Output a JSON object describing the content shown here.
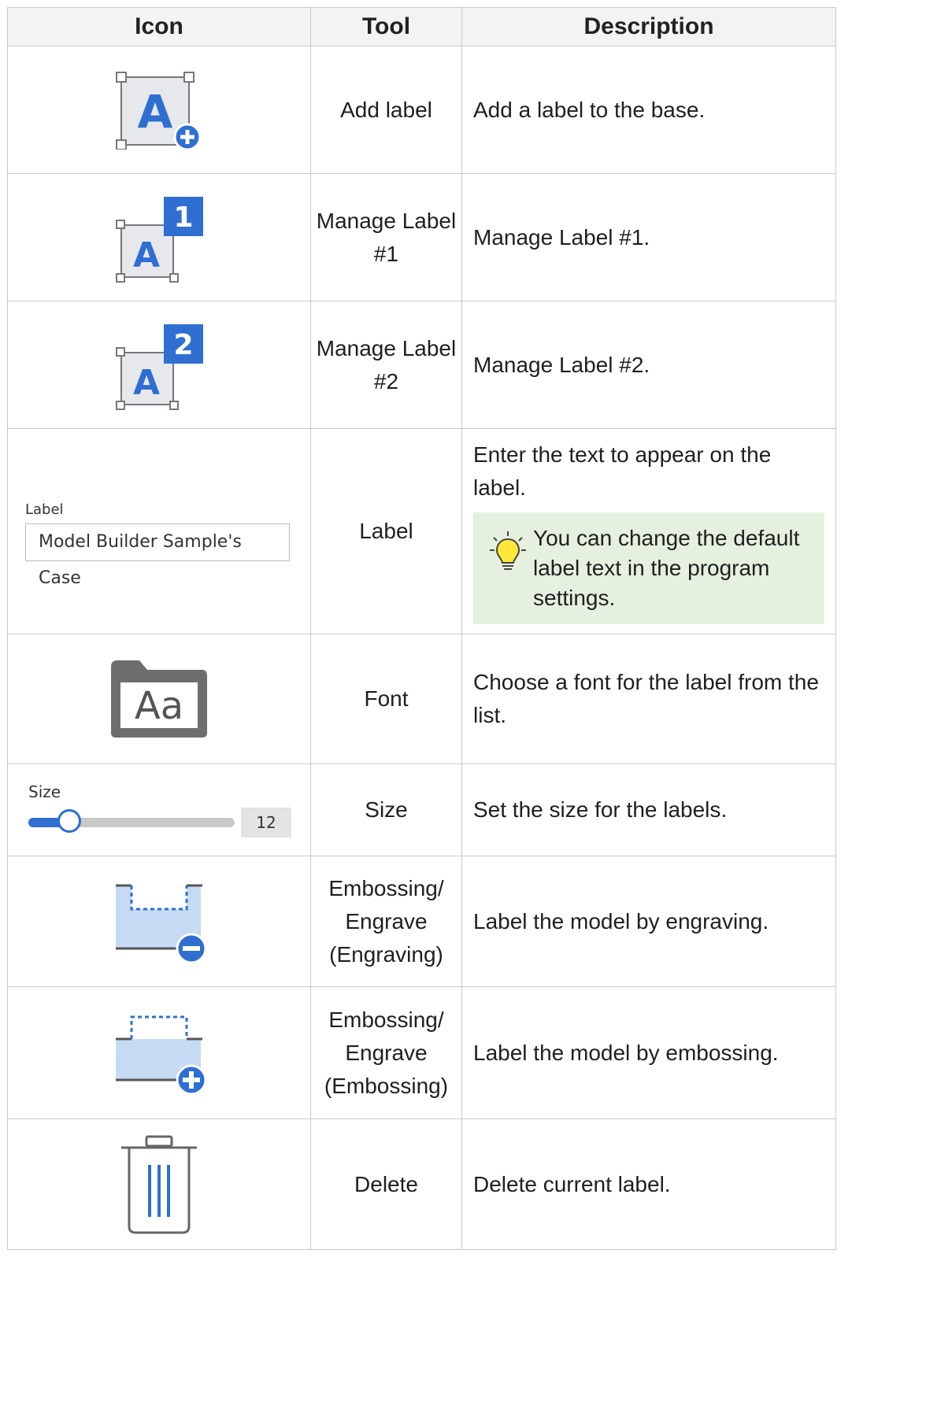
{
  "table": {
    "headers": [
      "Icon",
      "Tool",
      "Description"
    ],
    "rows": [
      {
        "icon": "add-label-icon",
        "tool": "Add label",
        "description": "Add a label to the base."
      },
      {
        "icon": "manage-label-1-icon",
        "tool": "Manage Label #1",
        "description": "Manage Label #1.",
        "badge": "1"
      },
      {
        "icon": "manage-label-2-icon",
        "tool": "Manage Label #2",
        "description": "Manage Label #2.",
        "badge": "2"
      },
      {
        "icon": "label-field-control",
        "tool": "Label",
        "description": "Enter the text to appear on the label.",
        "control": {
          "caption": "Label",
          "value": "Model Builder Sample's Case"
        },
        "tip": "You can change the default label text in the program settings."
      },
      {
        "icon": "font-icon",
        "tool": "Font",
        "description": "Choose a font for the label from the list.",
        "glyph": "Aa"
      },
      {
        "icon": "size-slider-control",
        "tool": "Size",
        "description": "Set the size for the labels.",
        "control": {
          "caption": "Size",
          "value": "12",
          "fraction": 0.2
        }
      },
      {
        "icon": "engrave-icon",
        "tool": "Embossing/ Engrave (Engraving)",
        "description": "Label the model by engraving."
      },
      {
        "icon": "emboss-icon",
        "tool": "Embossing/ Engrave (Embossing)",
        "description": "Label the model by embossing."
      },
      {
        "icon": "trash-icon",
        "tool": "Delete",
        "description": "Delete current label."
      }
    ]
  },
  "colors": {
    "accent": "#2f6fd1",
    "tip_bg": "#e5f0df",
    "header_bg": "#f3f3f3"
  }
}
